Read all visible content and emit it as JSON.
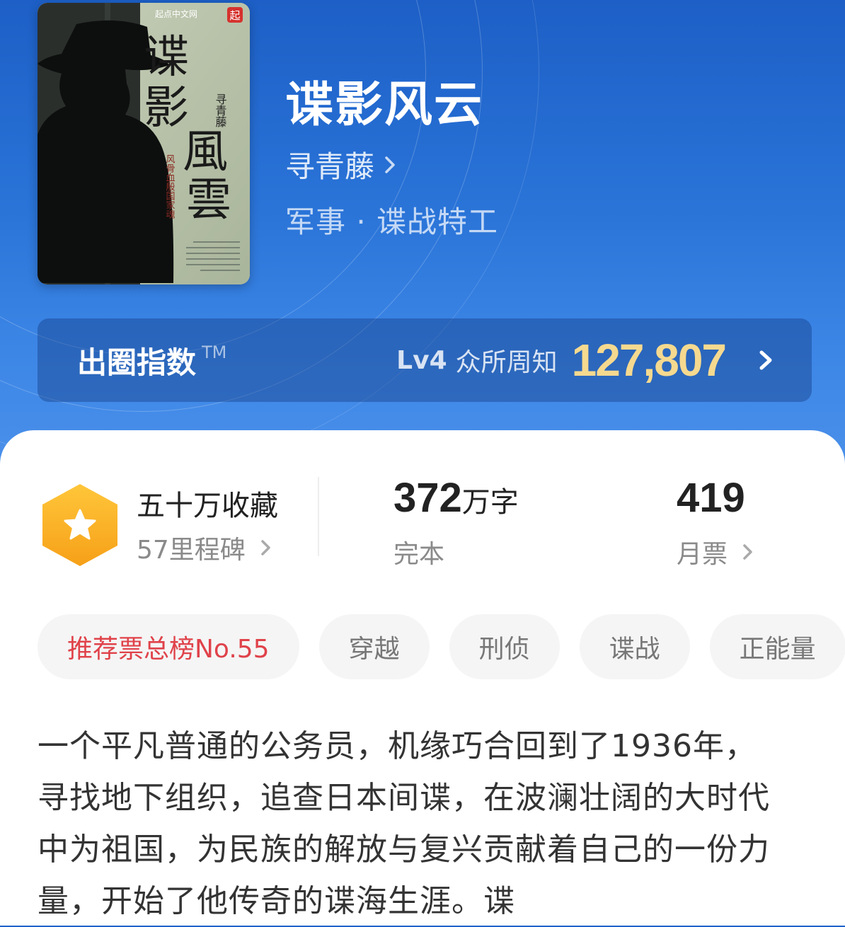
{
  "book": {
    "title": "谍影风云",
    "author": "寻青藤",
    "genre": "军事 · 谍战特工",
    "cover": {
      "publisher": "起点中文网",
      "publisher_badge": "起",
      "title_chars": [
        "谍",
        "影",
        "風",
        "雲"
      ],
      "author": "寻青藤",
      "tagline": "风骨血殷国家魂"
    }
  },
  "index": {
    "label": "出圈指数",
    "tm": "TM",
    "level": "Lv4",
    "level_text": "众所周知",
    "value": "127,807",
    "value_color": "#f5d98f"
  },
  "stats": {
    "milestone_title": "五十万收藏",
    "milestone_sub": "57里程碑",
    "words_num": "372",
    "words_unit": "万字",
    "status": "完本",
    "monthly_num": "419",
    "monthly_label": "月票"
  },
  "tags": [
    "推荐票总榜No.55",
    "穿越",
    "刑侦",
    "谍战",
    "正能量"
  ],
  "description": "一个平凡普通的公务员，机缘巧合回到了1936年，寻找地下组织，追查日本间谍，在波澜壮阔的大时代中为祖国，为民族的解放与复兴贡献着自己的一份力量，开始了他传奇的谍海生涯。谍",
  "colors": {
    "hero_blue": "#1f63c9",
    "accent_red": "#e0424a",
    "badge_orange": "#f6a018"
  },
  "icons": {
    "milestone": "star-hexagon-icon",
    "chevron": "chevron-right-icon"
  }
}
